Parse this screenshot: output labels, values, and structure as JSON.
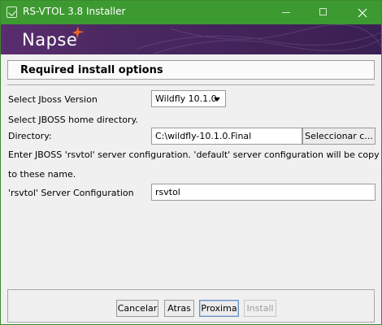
{
  "window": {
    "title": "RS-VTOL 3.8 Installer"
  },
  "banner": {
    "logo_text": "Napse"
  },
  "header": {
    "title": "Required install options"
  },
  "form": {
    "jboss_version_label": "Select Jboss Version",
    "jboss_version_value": "Wildfly 10.1.0",
    "home_dir_hint": "Select JBOSS home directory.",
    "directory_label": "Directory:",
    "directory_value": "C:\\wildfly-10.1.0.Final",
    "browse_button": "Seleccionar c...",
    "config_note_line1": "Enter JBOSS 'rsvtol' server configuration. 'default' server configuration will be copy",
    "config_note_line2": "to these name.",
    "server_config_label": "'rsvtol' Server Configuration",
    "server_config_value": "rsvtol"
  },
  "buttons": {
    "cancel": "Cancelar",
    "back": "Atras",
    "next": "Proxima",
    "install": "Install"
  },
  "colors": {
    "titlebar": "#3d9a31",
    "banner": "#4a2860",
    "logo_accent": "#f26522"
  }
}
